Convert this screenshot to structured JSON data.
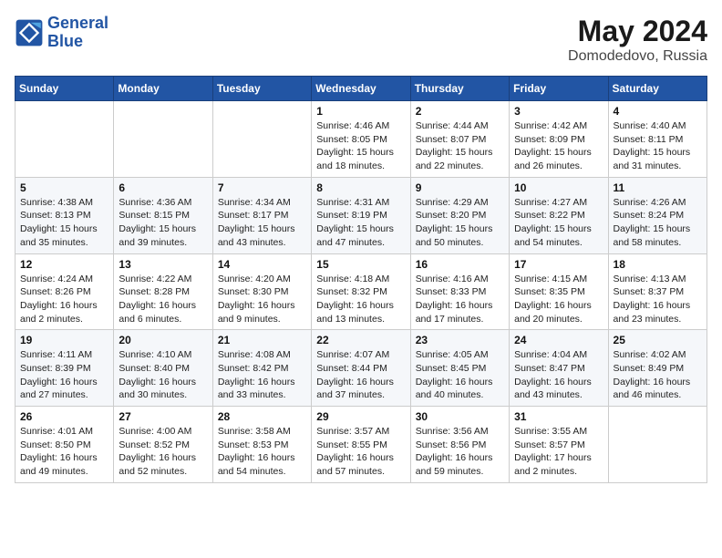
{
  "header": {
    "logo_line1": "General",
    "logo_line2": "Blue",
    "month": "May 2024",
    "location": "Domodedovo, Russia"
  },
  "weekdays": [
    "Sunday",
    "Monday",
    "Tuesday",
    "Wednesday",
    "Thursday",
    "Friday",
    "Saturday"
  ],
  "weeks": [
    [
      {
        "day": "",
        "info": ""
      },
      {
        "day": "",
        "info": ""
      },
      {
        "day": "",
        "info": ""
      },
      {
        "day": "1",
        "info": "Sunrise: 4:46 AM\nSunset: 8:05 PM\nDaylight: 15 hours\nand 18 minutes."
      },
      {
        "day": "2",
        "info": "Sunrise: 4:44 AM\nSunset: 8:07 PM\nDaylight: 15 hours\nand 22 minutes."
      },
      {
        "day": "3",
        "info": "Sunrise: 4:42 AM\nSunset: 8:09 PM\nDaylight: 15 hours\nand 26 minutes."
      },
      {
        "day": "4",
        "info": "Sunrise: 4:40 AM\nSunset: 8:11 PM\nDaylight: 15 hours\nand 31 minutes."
      }
    ],
    [
      {
        "day": "5",
        "info": "Sunrise: 4:38 AM\nSunset: 8:13 PM\nDaylight: 15 hours\nand 35 minutes."
      },
      {
        "day": "6",
        "info": "Sunrise: 4:36 AM\nSunset: 8:15 PM\nDaylight: 15 hours\nand 39 minutes."
      },
      {
        "day": "7",
        "info": "Sunrise: 4:34 AM\nSunset: 8:17 PM\nDaylight: 15 hours\nand 43 minutes."
      },
      {
        "day": "8",
        "info": "Sunrise: 4:31 AM\nSunset: 8:19 PM\nDaylight: 15 hours\nand 47 minutes."
      },
      {
        "day": "9",
        "info": "Sunrise: 4:29 AM\nSunset: 8:20 PM\nDaylight: 15 hours\nand 50 minutes."
      },
      {
        "day": "10",
        "info": "Sunrise: 4:27 AM\nSunset: 8:22 PM\nDaylight: 15 hours\nand 54 minutes."
      },
      {
        "day": "11",
        "info": "Sunrise: 4:26 AM\nSunset: 8:24 PM\nDaylight: 15 hours\nand 58 minutes."
      }
    ],
    [
      {
        "day": "12",
        "info": "Sunrise: 4:24 AM\nSunset: 8:26 PM\nDaylight: 16 hours\nand 2 minutes."
      },
      {
        "day": "13",
        "info": "Sunrise: 4:22 AM\nSunset: 8:28 PM\nDaylight: 16 hours\nand 6 minutes."
      },
      {
        "day": "14",
        "info": "Sunrise: 4:20 AM\nSunset: 8:30 PM\nDaylight: 16 hours\nand 9 minutes."
      },
      {
        "day": "15",
        "info": "Sunrise: 4:18 AM\nSunset: 8:32 PM\nDaylight: 16 hours\nand 13 minutes."
      },
      {
        "day": "16",
        "info": "Sunrise: 4:16 AM\nSunset: 8:33 PM\nDaylight: 16 hours\nand 17 minutes."
      },
      {
        "day": "17",
        "info": "Sunrise: 4:15 AM\nSunset: 8:35 PM\nDaylight: 16 hours\nand 20 minutes."
      },
      {
        "day": "18",
        "info": "Sunrise: 4:13 AM\nSunset: 8:37 PM\nDaylight: 16 hours\nand 23 minutes."
      }
    ],
    [
      {
        "day": "19",
        "info": "Sunrise: 4:11 AM\nSunset: 8:39 PM\nDaylight: 16 hours\nand 27 minutes."
      },
      {
        "day": "20",
        "info": "Sunrise: 4:10 AM\nSunset: 8:40 PM\nDaylight: 16 hours\nand 30 minutes."
      },
      {
        "day": "21",
        "info": "Sunrise: 4:08 AM\nSunset: 8:42 PM\nDaylight: 16 hours\nand 33 minutes."
      },
      {
        "day": "22",
        "info": "Sunrise: 4:07 AM\nSunset: 8:44 PM\nDaylight: 16 hours\nand 37 minutes."
      },
      {
        "day": "23",
        "info": "Sunrise: 4:05 AM\nSunset: 8:45 PM\nDaylight: 16 hours\nand 40 minutes."
      },
      {
        "day": "24",
        "info": "Sunrise: 4:04 AM\nSunset: 8:47 PM\nDaylight: 16 hours\nand 43 minutes."
      },
      {
        "day": "25",
        "info": "Sunrise: 4:02 AM\nSunset: 8:49 PM\nDaylight: 16 hours\nand 46 minutes."
      }
    ],
    [
      {
        "day": "26",
        "info": "Sunrise: 4:01 AM\nSunset: 8:50 PM\nDaylight: 16 hours\nand 49 minutes."
      },
      {
        "day": "27",
        "info": "Sunrise: 4:00 AM\nSunset: 8:52 PM\nDaylight: 16 hours\nand 52 minutes."
      },
      {
        "day": "28",
        "info": "Sunrise: 3:58 AM\nSunset: 8:53 PM\nDaylight: 16 hours\nand 54 minutes."
      },
      {
        "day": "29",
        "info": "Sunrise: 3:57 AM\nSunset: 8:55 PM\nDaylight: 16 hours\nand 57 minutes."
      },
      {
        "day": "30",
        "info": "Sunrise: 3:56 AM\nSunset: 8:56 PM\nDaylight: 16 hours\nand 59 minutes."
      },
      {
        "day": "31",
        "info": "Sunrise: 3:55 AM\nSunset: 8:57 PM\nDaylight: 17 hours\nand 2 minutes."
      },
      {
        "day": "",
        "info": ""
      }
    ]
  ]
}
